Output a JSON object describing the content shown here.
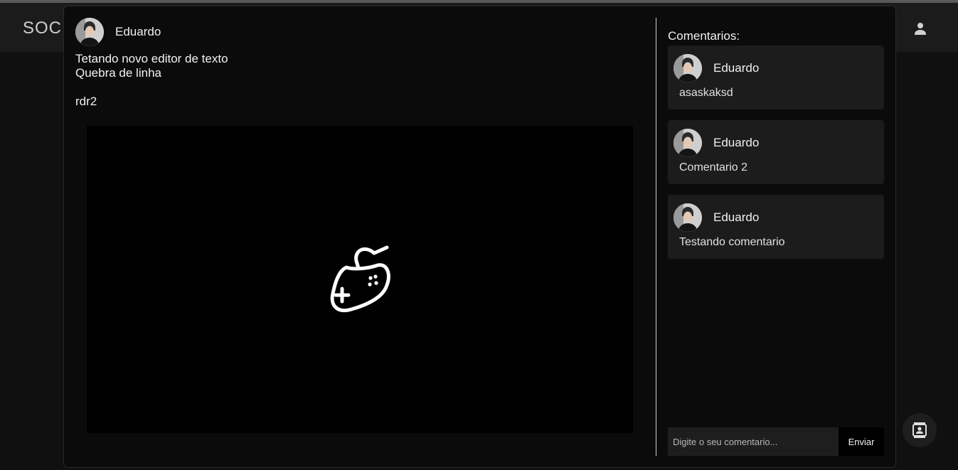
{
  "app": {
    "brand": "SOCIA"
  },
  "post": {
    "author": "Eduardo",
    "lines": [
      "Tetando novo editor de texto",
      "Quebra de linha",
      "",
      "rdr2"
    ],
    "media_icon": "gamepad-icon"
  },
  "comments": {
    "title": "Comentarios:",
    "items": [
      {
        "author": "Eduardo",
        "text": "asaskaksd"
      },
      {
        "author": "Eduardo",
        "text": "Comentario 2"
      },
      {
        "author": "Eduardo",
        "text": "Testando comentario"
      }
    ],
    "input_placeholder": "Digite o seu comentario...",
    "send_label": "Enviar"
  },
  "icons": {
    "user": "person-icon",
    "contacts": "contact-book-icon"
  },
  "colors": {
    "background": "#0a0a0a",
    "appbar": "#1b1b1b",
    "comment_card": "#1c1c1c"
  }
}
